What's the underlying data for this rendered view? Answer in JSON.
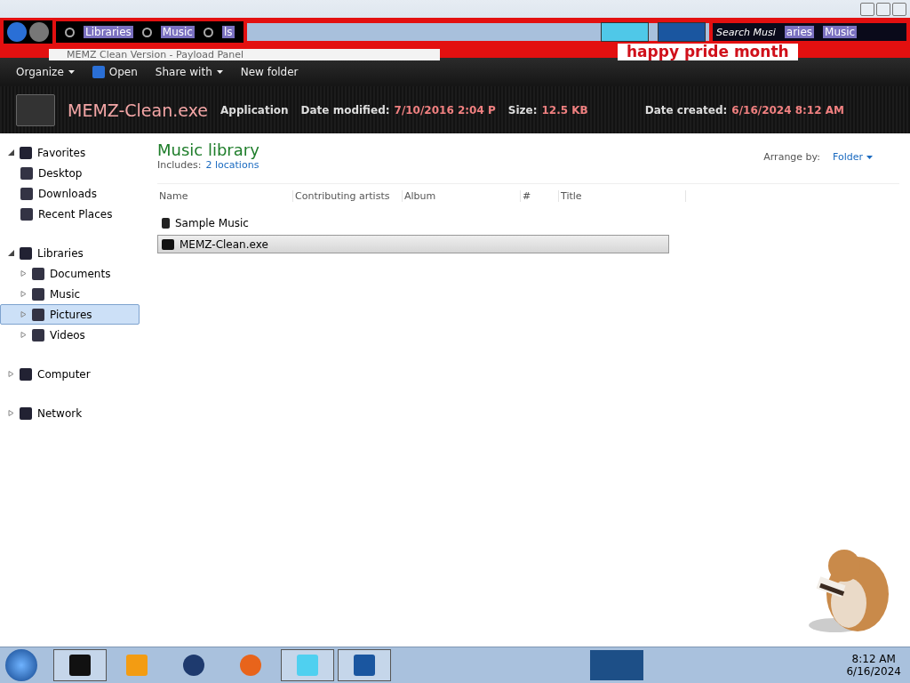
{
  "address_bar": {
    "crumbs": [
      {
        "label": "Libraries"
      },
      {
        "label": "Music"
      },
      {
        "label": "ls"
      }
    ],
    "search": {
      "placeholder": "Search Musi",
      "overlay": [
        "aries",
        "Music"
      ]
    }
  },
  "background_window": {
    "title": "MEMZ Clean Version - Payload Panel",
    "banner": "happy pride month"
  },
  "toolbar": {
    "items": [
      {
        "label": "Organize",
        "dropdown": true,
        "icon": false
      },
      {
        "label": "Open",
        "dropdown": false,
        "icon": true
      },
      {
        "label": "Share with",
        "dropdown": true,
        "icon": false
      },
      {
        "label": "New folder",
        "dropdown": false,
        "icon": false
      }
    ]
  },
  "details": {
    "name": "MEMZ-Clean.exe",
    "type": "Application",
    "fields": [
      {
        "label": "Date modified:",
        "value": "7/10/2016 2:04 P"
      },
      {
        "label": "Size:",
        "value": "12.5 KB"
      },
      {
        "label": "Date created:",
        "value": "6/16/2024 8:12 AM"
      }
    ]
  },
  "sidebar": {
    "groups": [
      {
        "label": "Favorites",
        "expanded": true,
        "children": [
          {
            "label": "Desktop",
            "selected": false
          },
          {
            "label": "Downloads",
            "selected": false
          },
          {
            "label": "Recent Places",
            "selected": false
          }
        ]
      },
      {
        "label": "Libraries",
        "expanded": true,
        "children": [
          {
            "label": "Documents",
            "selected": false
          },
          {
            "label": "Music",
            "selected": false
          },
          {
            "label": "Pictures",
            "selected": true
          },
          {
            "label": "Videos",
            "selected": false
          }
        ]
      },
      {
        "label": "Computer",
        "expanded": false
      },
      {
        "label": "Network",
        "expanded": false
      }
    ]
  },
  "library": {
    "title": "Music library",
    "includes_label": "Includes:",
    "includes_link": "2 locations",
    "arrange_label": "Arrange by:",
    "arrange_value": "Folder"
  },
  "table": {
    "columns": [
      "Name",
      "Contributing artists",
      "Album",
      "#",
      "Title"
    ],
    "rows": [
      {
        "name": "Sample Music",
        "kind": "folder",
        "selected": false
      },
      {
        "name": "MEMZ-Clean.exe",
        "kind": "app",
        "selected": true
      }
    ]
  },
  "taskbar": {
    "clock": {
      "time": "8:12 AM",
      "date": "6/16/2024"
    }
  }
}
